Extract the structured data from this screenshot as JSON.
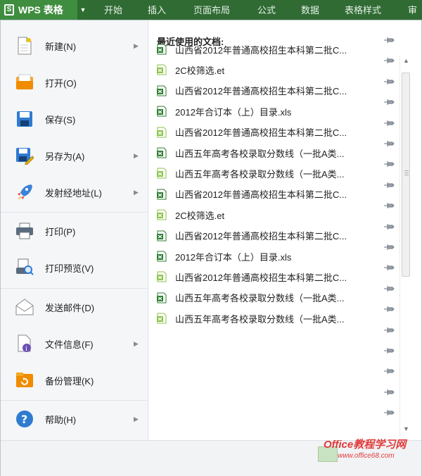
{
  "app": {
    "title": "WPS 表格"
  },
  "ribbon_tabs": [
    "开始",
    "插入",
    "页面布局",
    "公式",
    "数据",
    "表格样式",
    "审阅"
  ],
  "menu": [
    {
      "label": "新建(N)",
      "icon": "new-document-icon",
      "has_arrow": true
    },
    {
      "label": "打开(O)",
      "icon": "open-folder-icon",
      "has_arrow": false
    },
    {
      "label": "保存(S)",
      "icon": "floppy-disk-icon",
      "has_arrow": false
    },
    {
      "label": "另存为(A)",
      "icon": "save-as-icon",
      "has_arrow": true
    },
    {
      "label": "发射经地址(L)",
      "icon": "rocket-icon",
      "has_arrow": true
    },
    {
      "label": "打印(P)",
      "icon": "printer-icon",
      "has_arrow": false
    },
    {
      "label": "打印预览(V)",
      "icon": "print-preview-icon",
      "has_arrow": false
    },
    {
      "label": "发送邮件(D)",
      "icon": "envelope-icon",
      "has_arrow": false
    },
    {
      "label": "文件信息(F)",
      "icon": "file-info-icon",
      "has_arrow": true
    },
    {
      "label": "备份管理(K)",
      "icon": "backup-folder-icon",
      "has_arrow": false
    },
    {
      "label": "帮助(H)",
      "icon": "help-icon",
      "has_arrow": true
    }
  ],
  "recent": {
    "title": "最近使用的文档:",
    "files": [
      {
        "name": "山西省2012年普通高校招生本科第二批C...",
        "type": "xls"
      },
      {
        "name": "2C校筛选.et",
        "type": "et"
      },
      {
        "name": "山西省2012年普通高校招生本科第二批C...",
        "type": "xls"
      },
      {
        "name": "2012年合订本（上）目录.xls",
        "type": "xls"
      },
      {
        "name": "山西省2012年普通高校招生本科第二批C...",
        "type": "et"
      },
      {
        "name": "山西五年高考各校录取分数线（一批A类...",
        "type": "xls"
      },
      {
        "name": "山西五年高考各校录取分数线（一批A类...",
        "type": "et"
      },
      {
        "name": "山西省2012年普通高校招生本科第二批C...",
        "type": "xls"
      },
      {
        "name": "2C校筛选.et",
        "type": "et"
      },
      {
        "name": "山西省2012年普通高校招生本科第二批C...",
        "type": "xls"
      },
      {
        "name": "2012年合订本（上）目录.xls",
        "type": "xls"
      },
      {
        "name": "山西省2012年普通高校招生本科第二批C...",
        "type": "et"
      },
      {
        "name": "山西五年高考各校录取分数线（一批A类...",
        "type": "xls"
      },
      {
        "name": "山西五年高考各校录取分数线（一批A类...",
        "type": "et"
      }
    ]
  },
  "watermark": {
    "line1": "Office教程学习网",
    "line2": "www.office68.com"
  },
  "colors": {
    "ribbon": "#2f6b33",
    "app_button": "#3f8d3f",
    "xls_icon": "#2e7d32",
    "et_icon": "#8bc34a"
  }
}
